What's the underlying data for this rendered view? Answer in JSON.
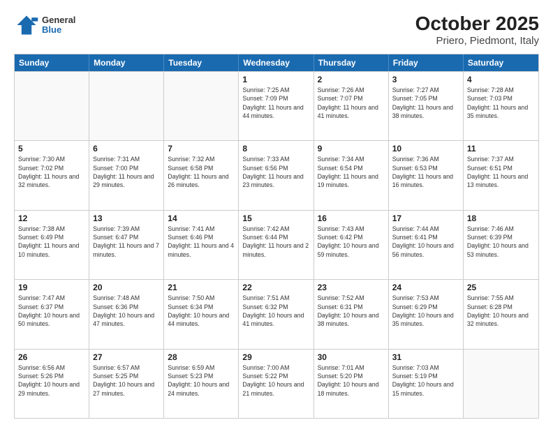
{
  "header": {
    "logo": {
      "general": "General",
      "blue": "Blue"
    },
    "title": "October 2025",
    "subtitle": "Priero, Piedmont, Italy"
  },
  "days_of_week": [
    "Sunday",
    "Monday",
    "Tuesday",
    "Wednesday",
    "Thursday",
    "Friday",
    "Saturday"
  ],
  "weeks": [
    [
      {
        "day": "",
        "sunrise": "",
        "sunset": "",
        "daylight": ""
      },
      {
        "day": "",
        "sunrise": "",
        "sunset": "",
        "daylight": ""
      },
      {
        "day": "",
        "sunrise": "",
        "sunset": "",
        "daylight": ""
      },
      {
        "day": "1",
        "sunrise": "Sunrise: 7:25 AM",
        "sunset": "Sunset: 7:09 PM",
        "daylight": "Daylight: 11 hours and 44 minutes."
      },
      {
        "day": "2",
        "sunrise": "Sunrise: 7:26 AM",
        "sunset": "Sunset: 7:07 PM",
        "daylight": "Daylight: 11 hours and 41 minutes."
      },
      {
        "day": "3",
        "sunrise": "Sunrise: 7:27 AM",
        "sunset": "Sunset: 7:05 PM",
        "daylight": "Daylight: 11 hours and 38 minutes."
      },
      {
        "day": "4",
        "sunrise": "Sunrise: 7:28 AM",
        "sunset": "Sunset: 7:03 PM",
        "daylight": "Daylight: 11 hours and 35 minutes."
      }
    ],
    [
      {
        "day": "5",
        "sunrise": "Sunrise: 7:30 AM",
        "sunset": "Sunset: 7:02 PM",
        "daylight": "Daylight: 11 hours and 32 minutes."
      },
      {
        "day": "6",
        "sunrise": "Sunrise: 7:31 AM",
        "sunset": "Sunset: 7:00 PM",
        "daylight": "Daylight: 11 hours and 29 minutes."
      },
      {
        "day": "7",
        "sunrise": "Sunrise: 7:32 AM",
        "sunset": "Sunset: 6:58 PM",
        "daylight": "Daylight: 11 hours and 26 minutes."
      },
      {
        "day": "8",
        "sunrise": "Sunrise: 7:33 AM",
        "sunset": "Sunset: 6:56 PM",
        "daylight": "Daylight: 11 hours and 23 minutes."
      },
      {
        "day": "9",
        "sunrise": "Sunrise: 7:34 AM",
        "sunset": "Sunset: 6:54 PM",
        "daylight": "Daylight: 11 hours and 19 minutes."
      },
      {
        "day": "10",
        "sunrise": "Sunrise: 7:36 AM",
        "sunset": "Sunset: 6:53 PM",
        "daylight": "Daylight: 11 hours and 16 minutes."
      },
      {
        "day": "11",
        "sunrise": "Sunrise: 7:37 AM",
        "sunset": "Sunset: 6:51 PM",
        "daylight": "Daylight: 11 hours and 13 minutes."
      }
    ],
    [
      {
        "day": "12",
        "sunrise": "Sunrise: 7:38 AM",
        "sunset": "Sunset: 6:49 PM",
        "daylight": "Daylight: 11 hours and 10 minutes."
      },
      {
        "day": "13",
        "sunrise": "Sunrise: 7:39 AM",
        "sunset": "Sunset: 6:47 PM",
        "daylight": "Daylight: 11 hours and 7 minutes."
      },
      {
        "day": "14",
        "sunrise": "Sunrise: 7:41 AM",
        "sunset": "Sunset: 6:46 PM",
        "daylight": "Daylight: 11 hours and 4 minutes."
      },
      {
        "day": "15",
        "sunrise": "Sunrise: 7:42 AM",
        "sunset": "Sunset: 6:44 PM",
        "daylight": "Daylight: 11 hours and 2 minutes."
      },
      {
        "day": "16",
        "sunrise": "Sunrise: 7:43 AM",
        "sunset": "Sunset: 6:42 PM",
        "daylight": "Daylight: 10 hours and 59 minutes."
      },
      {
        "day": "17",
        "sunrise": "Sunrise: 7:44 AM",
        "sunset": "Sunset: 6:41 PM",
        "daylight": "Daylight: 10 hours and 56 minutes."
      },
      {
        "day": "18",
        "sunrise": "Sunrise: 7:46 AM",
        "sunset": "Sunset: 6:39 PM",
        "daylight": "Daylight: 10 hours and 53 minutes."
      }
    ],
    [
      {
        "day": "19",
        "sunrise": "Sunrise: 7:47 AM",
        "sunset": "Sunset: 6:37 PM",
        "daylight": "Daylight: 10 hours and 50 minutes."
      },
      {
        "day": "20",
        "sunrise": "Sunrise: 7:48 AM",
        "sunset": "Sunset: 6:36 PM",
        "daylight": "Daylight: 10 hours and 47 minutes."
      },
      {
        "day": "21",
        "sunrise": "Sunrise: 7:50 AM",
        "sunset": "Sunset: 6:34 PM",
        "daylight": "Daylight: 10 hours and 44 minutes."
      },
      {
        "day": "22",
        "sunrise": "Sunrise: 7:51 AM",
        "sunset": "Sunset: 6:32 PM",
        "daylight": "Daylight: 10 hours and 41 minutes."
      },
      {
        "day": "23",
        "sunrise": "Sunrise: 7:52 AM",
        "sunset": "Sunset: 6:31 PM",
        "daylight": "Daylight: 10 hours and 38 minutes."
      },
      {
        "day": "24",
        "sunrise": "Sunrise: 7:53 AM",
        "sunset": "Sunset: 6:29 PM",
        "daylight": "Daylight: 10 hours and 35 minutes."
      },
      {
        "day": "25",
        "sunrise": "Sunrise: 7:55 AM",
        "sunset": "Sunset: 6:28 PM",
        "daylight": "Daylight: 10 hours and 32 minutes."
      }
    ],
    [
      {
        "day": "26",
        "sunrise": "Sunrise: 6:56 AM",
        "sunset": "Sunset: 5:26 PM",
        "daylight": "Daylight: 10 hours and 29 minutes."
      },
      {
        "day": "27",
        "sunrise": "Sunrise: 6:57 AM",
        "sunset": "Sunset: 5:25 PM",
        "daylight": "Daylight: 10 hours and 27 minutes."
      },
      {
        "day": "28",
        "sunrise": "Sunrise: 6:59 AM",
        "sunset": "Sunset: 5:23 PM",
        "daylight": "Daylight: 10 hours and 24 minutes."
      },
      {
        "day": "29",
        "sunrise": "Sunrise: 7:00 AM",
        "sunset": "Sunset: 5:22 PM",
        "daylight": "Daylight: 10 hours and 21 minutes."
      },
      {
        "day": "30",
        "sunrise": "Sunrise: 7:01 AM",
        "sunset": "Sunset: 5:20 PM",
        "daylight": "Daylight: 10 hours and 18 minutes."
      },
      {
        "day": "31",
        "sunrise": "Sunrise: 7:03 AM",
        "sunset": "Sunset: 5:19 PM",
        "daylight": "Daylight: 10 hours and 15 minutes."
      },
      {
        "day": "",
        "sunrise": "",
        "sunset": "",
        "daylight": ""
      }
    ]
  ]
}
